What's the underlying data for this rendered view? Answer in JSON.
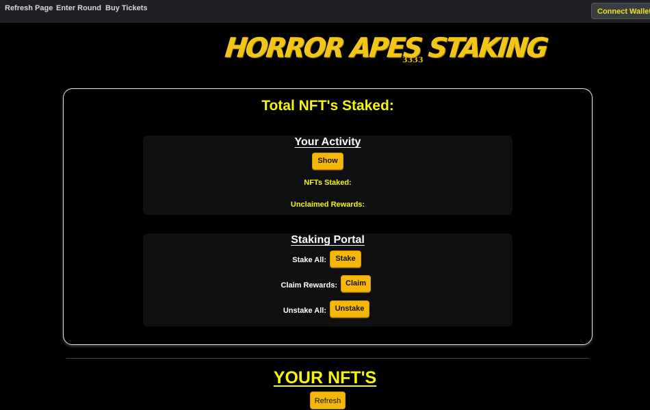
{
  "nav": {
    "links": [
      "Refresh Page",
      "Enter Round",
      "Buy Tickets"
    ],
    "connect_wallet": "Connect Wallet"
  },
  "logo": {
    "title": "HORROR APES STAKING",
    "subtitle": "3333"
  },
  "card": {
    "title": "Total NFT's Staked:"
  },
  "activity": {
    "title": "Your Activity",
    "show_button": "Show",
    "nfts_staked_label": "NFTs Staked:",
    "unclaimed_rewards_label": "Unclaimed Rewards:"
  },
  "portal": {
    "title": "Staking Portal",
    "stake_all_label": "Stake All:",
    "stake_button": "Stake",
    "claim_rewards_label": "Claim Rewards:",
    "claim_button": "Claim",
    "unstake_all_label": "Unstake All:",
    "unstake_button": "Unstake"
  },
  "nfts": {
    "title": "YOUR NFT'S",
    "refresh_button": "Refresh"
  },
  "colors": {
    "background": "#000000",
    "accent_yellow": "#f5f512",
    "button_yellow": "#f5b80a",
    "logo_gold": "#f2c517",
    "panel": "#0f1012"
  }
}
